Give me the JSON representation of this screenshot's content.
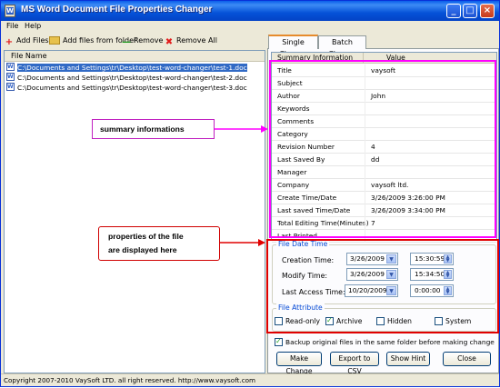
{
  "window": {
    "title": "MS Word Document File Properties Changer",
    "icon": "word-doc-icon",
    "controls": [
      "minimize-icon",
      "maximize-icon",
      "close-icon"
    ]
  },
  "menu": {
    "file": "File",
    "help": "Help"
  },
  "toolbar": {
    "add_files": "Add Files",
    "add_folder": "Add files from folder",
    "remove": "Remove",
    "remove_all": "Remove All"
  },
  "file_list": {
    "header": "File Name",
    "files": [
      "C:\\Documents and Settings\\tr\\Desktop\\test-word-changer\\test-1.doc",
      "C:\\Documents and Settings\\tr\\Desktop\\test-word-changer\\test-2.doc",
      "C:\\Documents and Settings\\tr\\Desktop\\test-word-changer\\test-3.doc"
    ],
    "selected_index": 0
  },
  "tabs": [
    "Single Change",
    "Batch Change"
  ],
  "active_tab": "Single Change",
  "summary": {
    "col_key": "Summary Information",
    "col_val": "Value",
    "rows": [
      {
        "k": "Title",
        "v": "vaysoft"
      },
      {
        "k": "Subject",
        "v": ""
      },
      {
        "k": "Author",
        "v": "John"
      },
      {
        "k": "Keywords",
        "v": ""
      },
      {
        "k": "Comments",
        "v": ""
      },
      {
        "k": "Category",
        "v": ""
      },
      {
        "k": "Revision Number",
        "v": "4"
      },
      {
        "k": "Last Saved By",
        "v": "dd"
      },
      {
        "k": "Manager",
        "v": ""
      },
      {
        "k": "Company",
        "v": "vaysoft ltd."
      },
      {
        "k": "Create Time/Date",
        "v": "3/26/2009 3:26:00 PM"
      },
      {
        "k": "Last saved Time/Date",
        "v": "3/26/2009 3:34:00 PM"
      },
      {
        "k": "Total Editing Time(Minutes)",
        "v": "7"
      },
      {
        "k": "Last Printed",
        "v": ""
      }
    ]
  },
  "file_date_time": {
    "label": "File Date Time",
    "creation": {
      "label": "Creation Time:",
      "date": "3/26/2009",
      "time": "15:30:59"
    },
    "modify": {
      "label": "Modify Time:",
      "date": "3/26/2009",
      "time": "15:34:50"
    },
    "access": {
      "label": "Last Access Time:",
      "date": "10/20/2009",
      "time": "0:00:00"
    }
  },
  "file_attribute": {
    "label": "File Attribute",
    "items": [
      {
        "label": "Read-only",
        "checked": false
      },
      {
        "label": "Archive",
        "checked": true
      },
      {
        "label": "Hidden",
        "checked": false
      },
      {
        "label": "System",
        "checked": false
      }
    ]
  },
  "backup": {
    "label": "Backup original files in the same folder before making change",
    "checked": true
  },
  "buttons": {
    "make_change": "Make Change",
    "export_csv": "Export to CSV",
    "show_hint": "Show Hint",
    "close": "Close"
  },
  "status": "Copyright 2007-2010 VaySoft LTD. all right reserved. http://www.vaysoft.com",
  "annotations": {
    "summary": "summary informations",
    "props_l1": "properties of the file",
    "props_l2": "are displayed here"
  },
  "colors": {
    "titlebar": "#0552D8",
    "selection": "#316AC5",
    "group_label": "#0046D5",
    "annot_magenta": "#ff00ff",
    "annot_red": "#e00000"
  }
}
